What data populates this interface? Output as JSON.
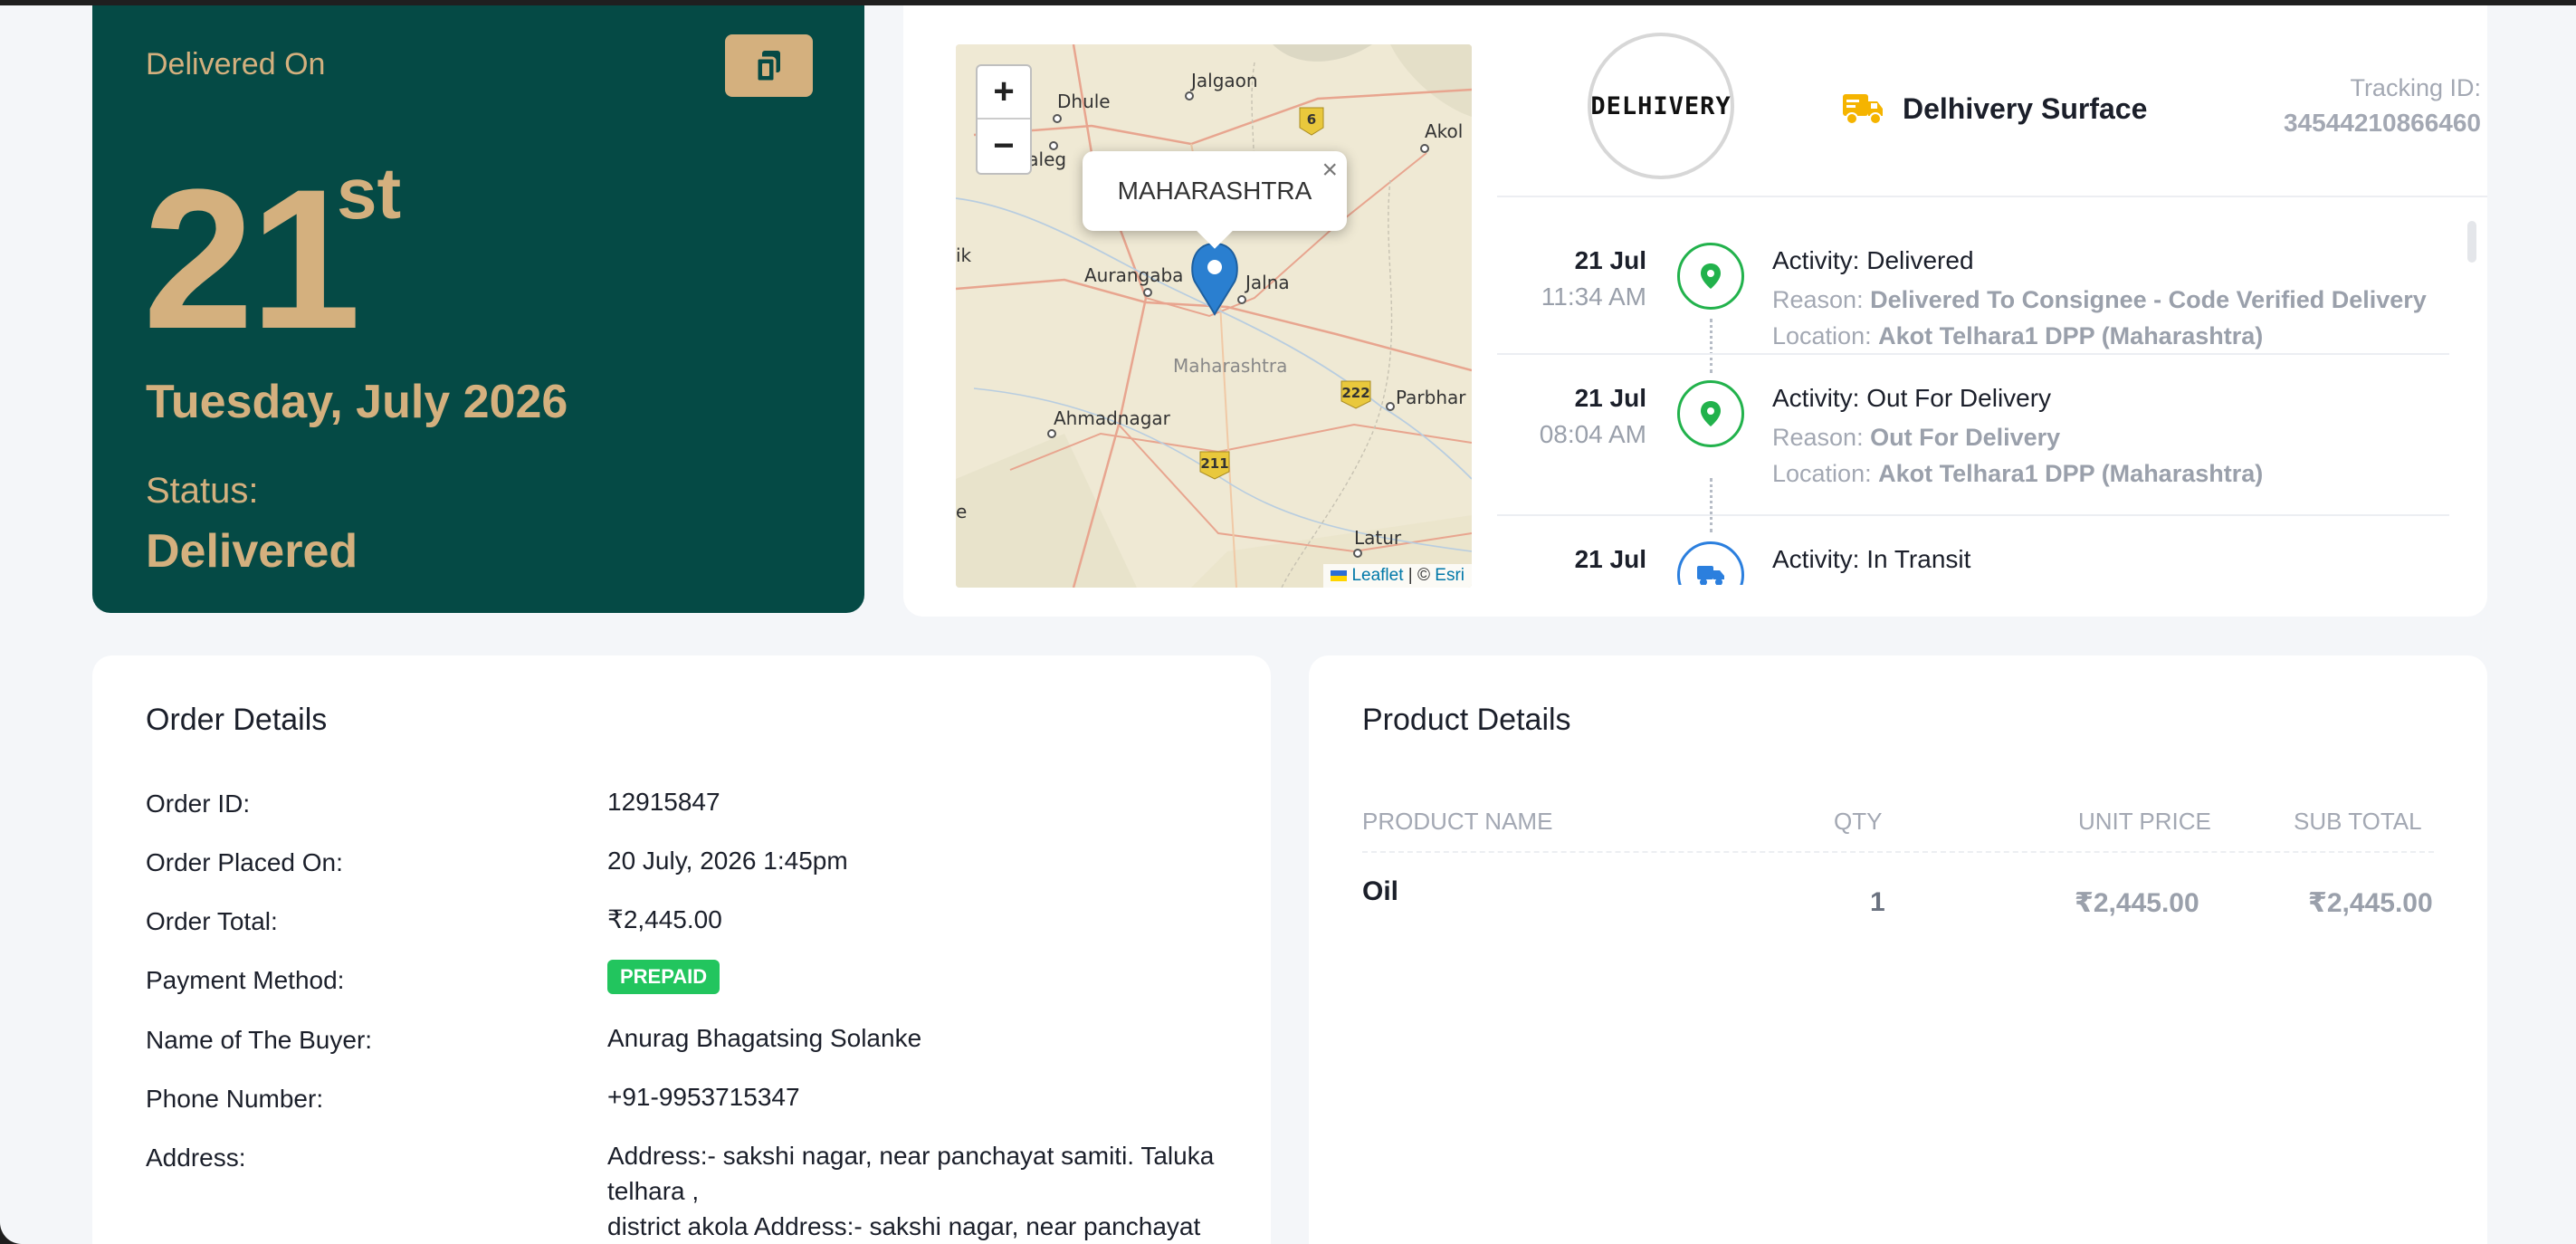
{
  "delivery": {
    "label": "Delivered On",
    "day": "21",
    "suffix": "st",
    "full_date": "Tuesday, July 2026",
    "status_label": "Status:",
    "status_value": "Delivered"
  },
  "map": {
    "zoom_in": "+",
    "zoom_out": "−",
    "popup_text": "MAHARASHTRA",
    "popup_close": "×",
    "places": [
      "Dhule",
      "Jalgaon",
      "Akol",
      "Aurangaba",
      "Jalna",
      "Maharashtra",
      "Ahmadnagar",
      "Parbhar",
      "Latur",
      "Maleg",
      "ik",
      "e"
    ],
    "shields": [
      "6",
      "222",
      "211"
    ],
    "attribution_leaflet": "Leaflet",
    "attribution_sep": "| ©",
    "attribution_esri": "Esri"
  },
  "carrier": {
    "logo_text": "DELHIVERY",
    "name": "Delhivery Surface",
    "tracking_label": "Tracking ID:",
    "tracking_id": "34544210866460"
  },
  "activities": [
    {
      "date": "21 Jul",
      "time": "11:34 AM",
      "icon": "location-pin-icon",
      "title": "Activity: Delivered",
      "reason_label": "Reason:",
      "reason": "Delivered To Consignee - Code Verified Delivery",
      "location_label": "Location:",
      "location": "Akot Telhara1 DPP (Maharashtra)"
    },
    {
      "date": "21 Jul",
      "time": "08:04 AM",
      "icon": "location-pin-icon",
      "title": "Activity: Out For Delivery",
      "reason_label": "Reason:",
      "reason": "Out For Delivery",
      "location_label": "Location:",
      "location": "Akot Telhara1 DPP (Maharashtra)"
    },
    {
      "date": "21 Jul",
      "icon": "truck-icon",
      "title": "Activity: In Transit"
    }
  ],
  "order": {
    "title": "Order Details",
    "rows": [
      {
        "key": "Order ID:",
        "value": "12915847"
      },
      {
        "key": "Order Placed On:",
        "value": "20 July, 2026 1:45pm"
      },
      {
        "key": "Order Total:",
        "value": "₹2,445.00"
      },
      {
        "key": "Payment Method:",
        "value": "PREPAID"
      },
      {
        "key": "Name of The Buyer:",
        "value": "Anurag Bhagatsing Solanke"
      },
      {
        "key": "Phone Number:",
        "value": "+91-9953715347"
      },
      {
        "key": "Address:",
        "value": "Address:- sakshi nagar, near panchayat samiti. Taluka telhara ,",
        "value2": "district akola Address:- sakshi nagar, near panchayat"
      }
    ]
  },
  "product": {
    "title": "Product Details",
    "columns": [
      "PRODUCT NAME",
      "QTY",
      "UNIT PRICE",
      "SUB TOTAL"
    ],
    "rows": [
      {
        "name": "Oil",
        "qty": "1",
        "unit_price": "₹2,445.00",
        "sub_total": "₹2,445.00"
      }
    ]
  },
  "colors": {
    "delivered_bg": "#054a45",
    "gold": "#d4b07e",
    "success": "#22c55e",
    "muted": "#a3a8b3"
  }
}
